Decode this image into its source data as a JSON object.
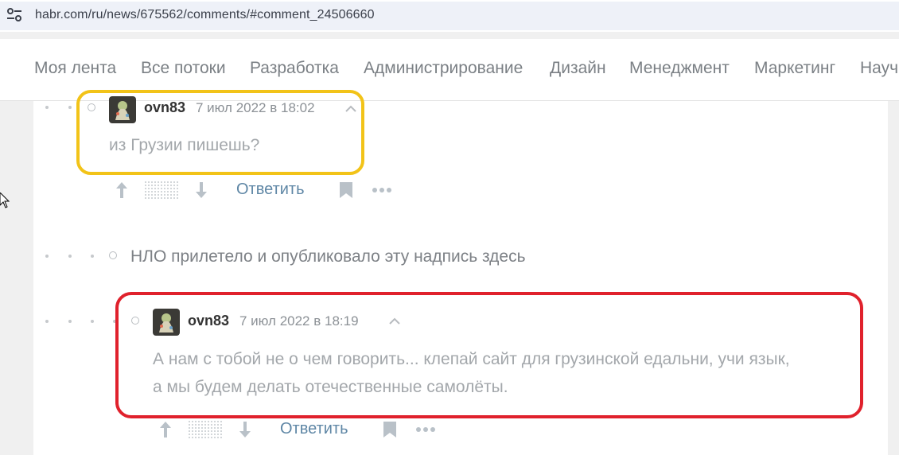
{
  "browser": {
    "url": "habr.com/ru/news/675562/comments/#comment_24506660",
    "site_info_icon": "tune-icon"
  },
  "nav": {
    "items": [
      "Моя лента",
      "Все потоки",
      "Разработка",
      "Администрирование",
      "Дизайн",
      "Менеджмент",
      "Маркетинг",
      "Науч"
    ]
  },
  "comments": [
    {
      "author": "ovn83",
      "date": "7 июл 2022 в 18:02",
      "text": "из Грузии пишешь?",
      "reply_label": "Ответить"
    },
    {
      "placeholder_text": "НЛО прилетело и опубликовало эту надпись здесь"
    },
    {
      "author": "ovn83",
      "date": "7 июл 2022 в 18:19",
      "text_lines": [
        "А нам с тобой не о чем говорить... клепай сайт для грузинской едальни, учи язык,",
        "а мы будем делать отечественные самолёты."
      ],
      "reply_label": "Ответить"
    }
  ],
  "colors": {
    "highlight_1": "#f2c318",
    "highlight_2": "#e0212c",
    "link": "#5e86a5"
  },
  "icons": [
    "upvote-icon",
    "downvote-icon",
    "bookmark-icon",
    "more-icon",
    "collapse-chevron-icon",
    "avatar"
  ]
}
